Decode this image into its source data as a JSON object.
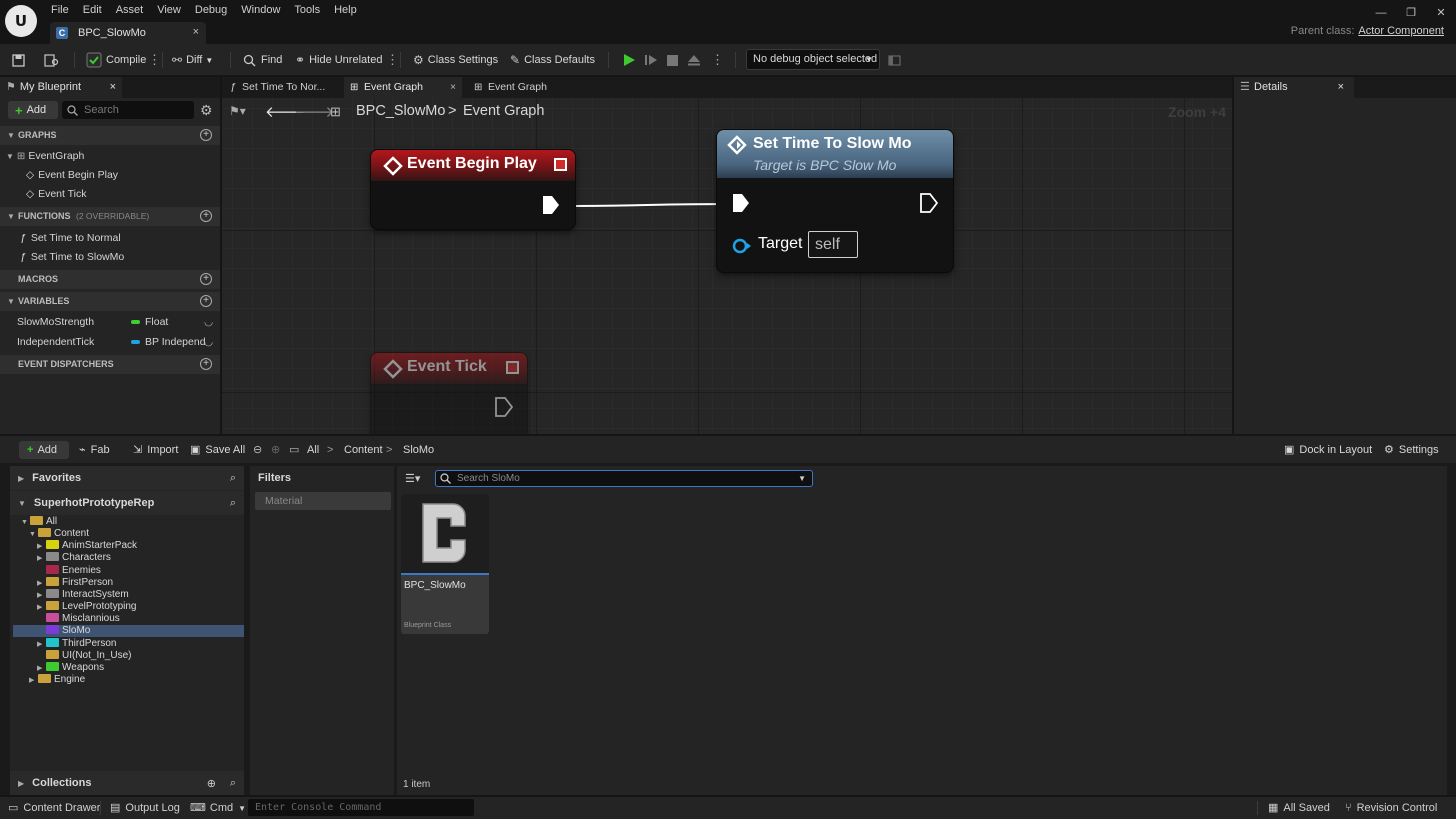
{
  "app": {
    "logo_text": "U"
  },
  "menu": [
    "File",
    "Edit",
    "Asset",
    "View",
    "Debug",
    "Window",
    "Tools",
    "Help"
  ],
  "doc_tab": {
    "label": "BPC_SlowMo",
    "close": "×",
    "icon": "blueprint-icon"
  },
  "window_controls": {
    "minimize": "—",
    "restore": "❐",
    "close": "✕"
  },
  "parent_class": {
    "label": "Parent class:",
    "value": "Actor Component"
  },
  "toolbar": {
    "compile": "Compile",
    "diff": "Diff",
    "find": "Find",
    "hide_unrelated": "Hide Unrelated",
    "class_settings": "Class Settings",
    "class_defaults": "Class Defaults",
    "debug_object": "No debug object selected"
  },
  "my_blueprint": {
    "tab_label": "My Blueprint",
    "add_label": "Add",
    "search_placeholder": "Search",
    "graphs_header": "GRAPHS",
    "graph_root": "EventGraph",
    "graph_items": [
      "Event Begin Play",
      "Event Tick"
    ],
    "functions_header": "FUNCTIONS",
    "functions_note": "(2 OVERRIDABLE)",
    "functions": [
      "Set Time to Normal",
      "Set Time to SlowMo"
    ],
    "macros_header": "MACROS",
    "variables_header": "VARIABLES",
    "variables": [
      {
        "name": "SlowMoStrength",
        "type": "Float",
        "color": "#3ed12e"
      },
      {
        "name": "IndependentTick",
        "type": "BP Independ",
        "color": "#1fa2e8"
      }
    ],
    "dispatchers_header": "EVENT DISPATCHERS"
  },
  "graph": {
    "tabs": [
      {
        "label": "Set Time To Nor...",
        "active": false
      },
      {
        "label": "Event Graph",
        "active": true
      },
      {
        "label": "Event Graph",
        "active": false
      }
    ],
    "breadcrumb": {
      "root": "BPC_SlowMo",
      "separator": ">",
      "current": "Event Graph"
    },
    "zoom": "Zoom +4",
    "nodes": {
      "begin_play": {
        "title": "Event Begin Play"
      },
      "set_slowmo": {
        "title": "Set Time To Slow Mo",
        "subtitle": "Target is BPC Slow Mo",
        "target_label": "Target",
        "target_value": "self"
      },
      "event_tick": {
        "title": "Event Tick"
      }
    }
  },
  "details": {
    "tab_label": "Details"
  },
  "content_drawer": {
    "add": "Add",
    "fab": "Fab",
    "import": "Import",
    "save_all": "Save All",
    "path": [
      "All",
      "Content",
      "SloMo"
    ],
    "dock_in_layout": "Dock in Layout",
    "settings": "Settings",
    "favorites": "Favorites",
    "project": "SuperhotPrototypeRep",
    "collections": "Collections",
    "filters_header": "Filters",
    "filter_material": "Material",
    "search_placeholder": "Search SloMo",
    "item_count": "1 item",
    "tree": [
      {
        "label": "All",
        "depth": 0,
        "color": "#c9a23c",
        "expanded": true
      },
      {
        "label": "Content",
        "depth": 1,
        "color": "#c9a23c",
        "expanded": true
      },
      {
        "label": "AnimStarterPack",
        "depth": 2,
        "color": "#d6d40f",
        "arrow": true
      },
      {
        "label": "Characters",
        "depth": 2,
        "color": "#8a8a8a",
        "arrow": true
      },
      {
        "label": "Enemies",
        "depth": 2,
        "color": "#a8284b",
        "arrow": false
      },
      {
        "label": "FirstPerson",
        "depth": 2,
        "color": "#c9a23c",
        "arrow": true
      },
      {
        "label": "InteractSystem",
        "depth": 2,
        "color": "#8a8a8a",
        "arrow": true
      },
      {
        "label": "LevelPrototyping",
        "depth": 2,
        "color": "#c9a23c",
        "arrow": true
      },
      {
        "label": "Misclannious",
        "depth": 2,
        "color": "#c94f9d",
        "arrow": false
      },
      {
        "label": "SloMo",
        "depth": 2,
        "color": "#7a3bd6",
        "arrow": false,
        "selected": true
      },
      {
        "label": "ThirdPerson",
        "depth": 2,
        "color": "#22c4c9",
        "arrow": true
      },
      {
        "label": "UI(Not_In_Use)",
        "depth": 2,
        "color": "#c9a23c",
        "arrow": false
      },
      {
        "label": "Weapons",
        "depth": 2,
        "color": "#3ec92e",
        "arrow": true
      },
      {
        "label": "Engine",
        "depth": 1,
        "color": "#c9a23c",
        "arrow": true
      }
    ],
    "asset": {
      "name": "BPC_SlowMo",
      "type": "Blueprint Class"
    }
  },
  "statusbar": {
    "content_drawer": "Content Drawer",
    "output_log": "Output Log",
    "cmd": "Cmd",
    "console_placeholder": "Enter Console Command",
    "all_saved": "All Saved",
    "revision_control": "Revision Control"
  }
}
